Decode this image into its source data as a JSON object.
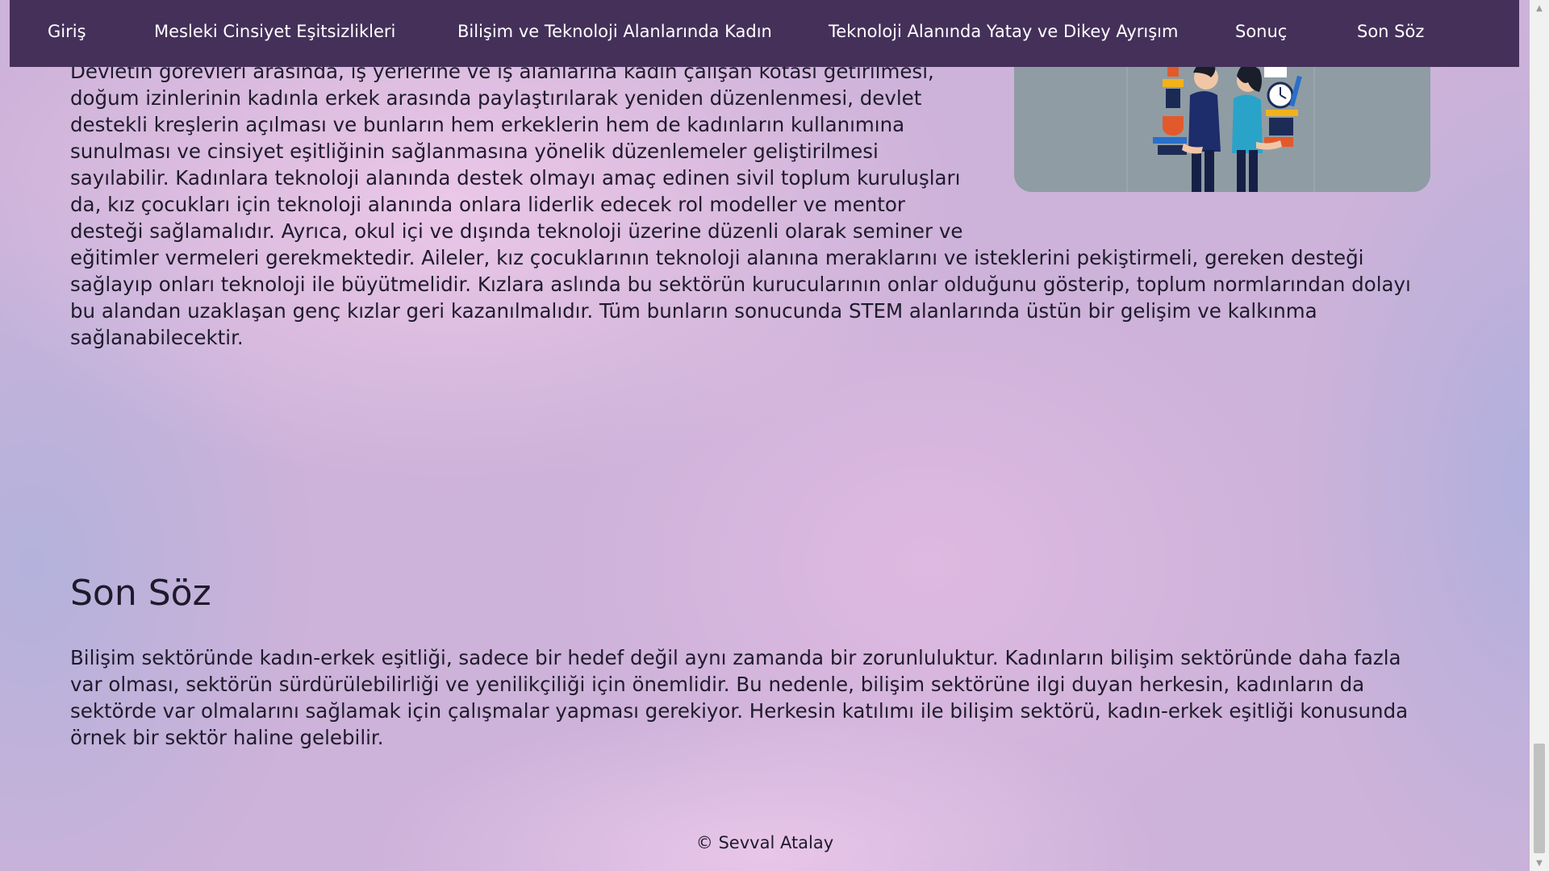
{
  "nav": {
    "items": [
      {
        "label": "Giriş"
      },
      {
        "label": "Mesleki Cinsiyet Eşitsizlikleri"
      },
      {
        "label": "Bilişim ve Teknoloji Alanlarında Kadın"
      },
      {
        "label": "Teknoloji Alanında Yatay ve Dikey Ayrışım"
      },
      {
        "label": "Sonuç"
      },
      {
        "label": "Son Söz"
      }
    ]
  },
  "article": {
    "top_lines": [
      "Devletin görevleri arasında, iş yerlerine ve iş alanlarına kadın çalışan kotası getirilmesi,",
      "doğum izinlerinin kadınla erkek arasında paylaştırılarak yeniden düzenlenmesi, devlet",
      "destekli kreşlerin açılması ve bunların hem erkeklerin hem de kadınların kullanımına",
      "sunulması ve cinsiyet eşitliğinin sağlanmasına yönelik düzenlemeler geliştirilmesi",
      "sayılabilir. Kadınlara teknoloji alanında destek olmayı amaç edinen sivil toplum kuruluşları",
      "da, kız çocukları için teknoloji alanında onlara liderlik edecek rol modeller ve mentor",
      "desteği sağlamalıdır. Ayrıca, okul içi ve dışında teknoloji üzerine düzenli olarak seminer ve"
    ],
    "wide_lines": [
      "eğitimler vermeleri gerekmektedir. Aileler, kız çocuklarının teknoloji alanına meraklarını ve isteklerini pekiştirmeli, gereken desteği",
      "sağlayıp onları teknoloji ile büyütmelidir. Kızlara aslında bu sektörün kurucularının onlar olduğunu gösterip, toplum normlarından dolayı",
      "bu alandan uzaklaşan genç kızlar geri kazanılmalıdır. Tüm bunların sonucunda STEM alanlarında üstün bir gelişim ve kalkınma",
      "sağlanabilecektir."
    ]
  },
  "son_soz": {
    "heading": "Son Söz",
    "lines": [
      "Bilişim sektöründe kadın-erkek eşitliği, sadece bir hedef değil aynı zamanda bir zorunluluktur. Kadınların bilişim sektöründe daha fazla",
      "var olması, sektörün sürdürülebilirliği ve yenilikçiliği için önemlidir. Bu nedenle, bilişim sektörüne ilgi duyan herkesin, kadınların da",
      "sektörde var olmalarını sağlamak için çalışmalar yapması gerekiyor. Herkesin katılımı ile bilişim sektörü, kadın-erkek eşitliği konusunda",
      "örnek bir sektör haline gelebilir."
    ]
  },
  "footer": {
    "text": "© Sevval Atalay"
  },
  "colors": {
    "nav_bg": "#45305a",
    "nav_text": "#ffffff",
    "text": "#1e1a2b",
    "illustration_bg": "#8f9ca4"
  },
  "icons": {
    "scroll_up": "chevron-up-icon",
    "scroll_down": "chevron-down-icon"
  }
}
